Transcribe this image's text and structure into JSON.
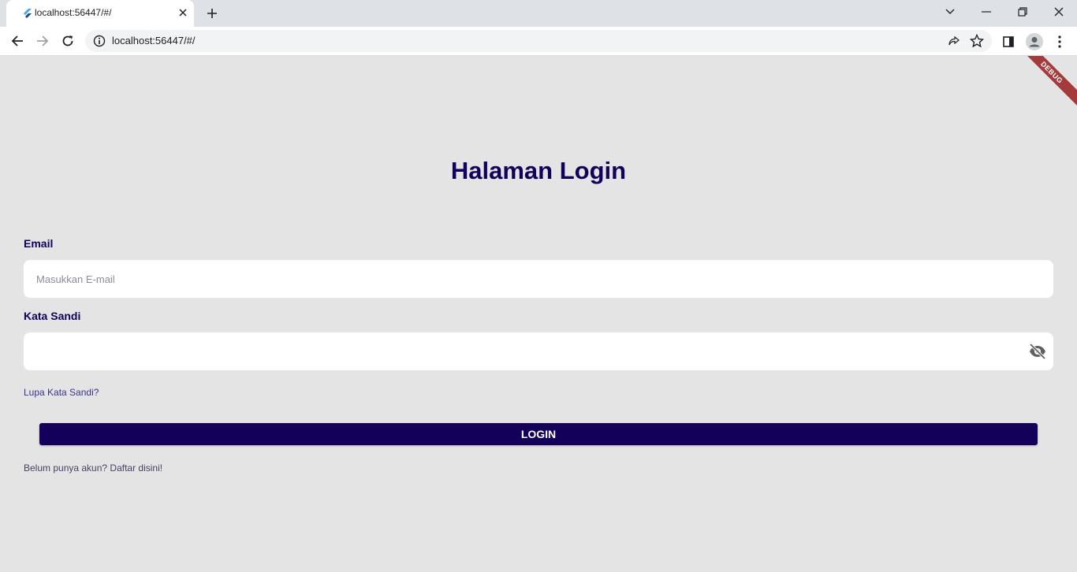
{
  "browser": {
    "tab_title": "localhost:56447/#/",
    "url": "localhost:56447/#/"
  },
  "app": {
    "debug_banner": "DEBUG",
    "title": "Halaman Login",
    "email_label": "Email",
    "email_placeholder": "Masukkan E-mail",
    "email_value": "",
    "password_label": "Kata Sandi",
    "password_value": "",
    "forgot_password": "Lupa Kata Sandi?",
    "login_button": "LOGIN",
    "register_prompt": "Belum punya akun? Daftar disini!"
  },
  "colors": {
    "primary": "#13005a",
    "background": "#e4e4e4",
    "debug": "#a43a3a"
  }
}
